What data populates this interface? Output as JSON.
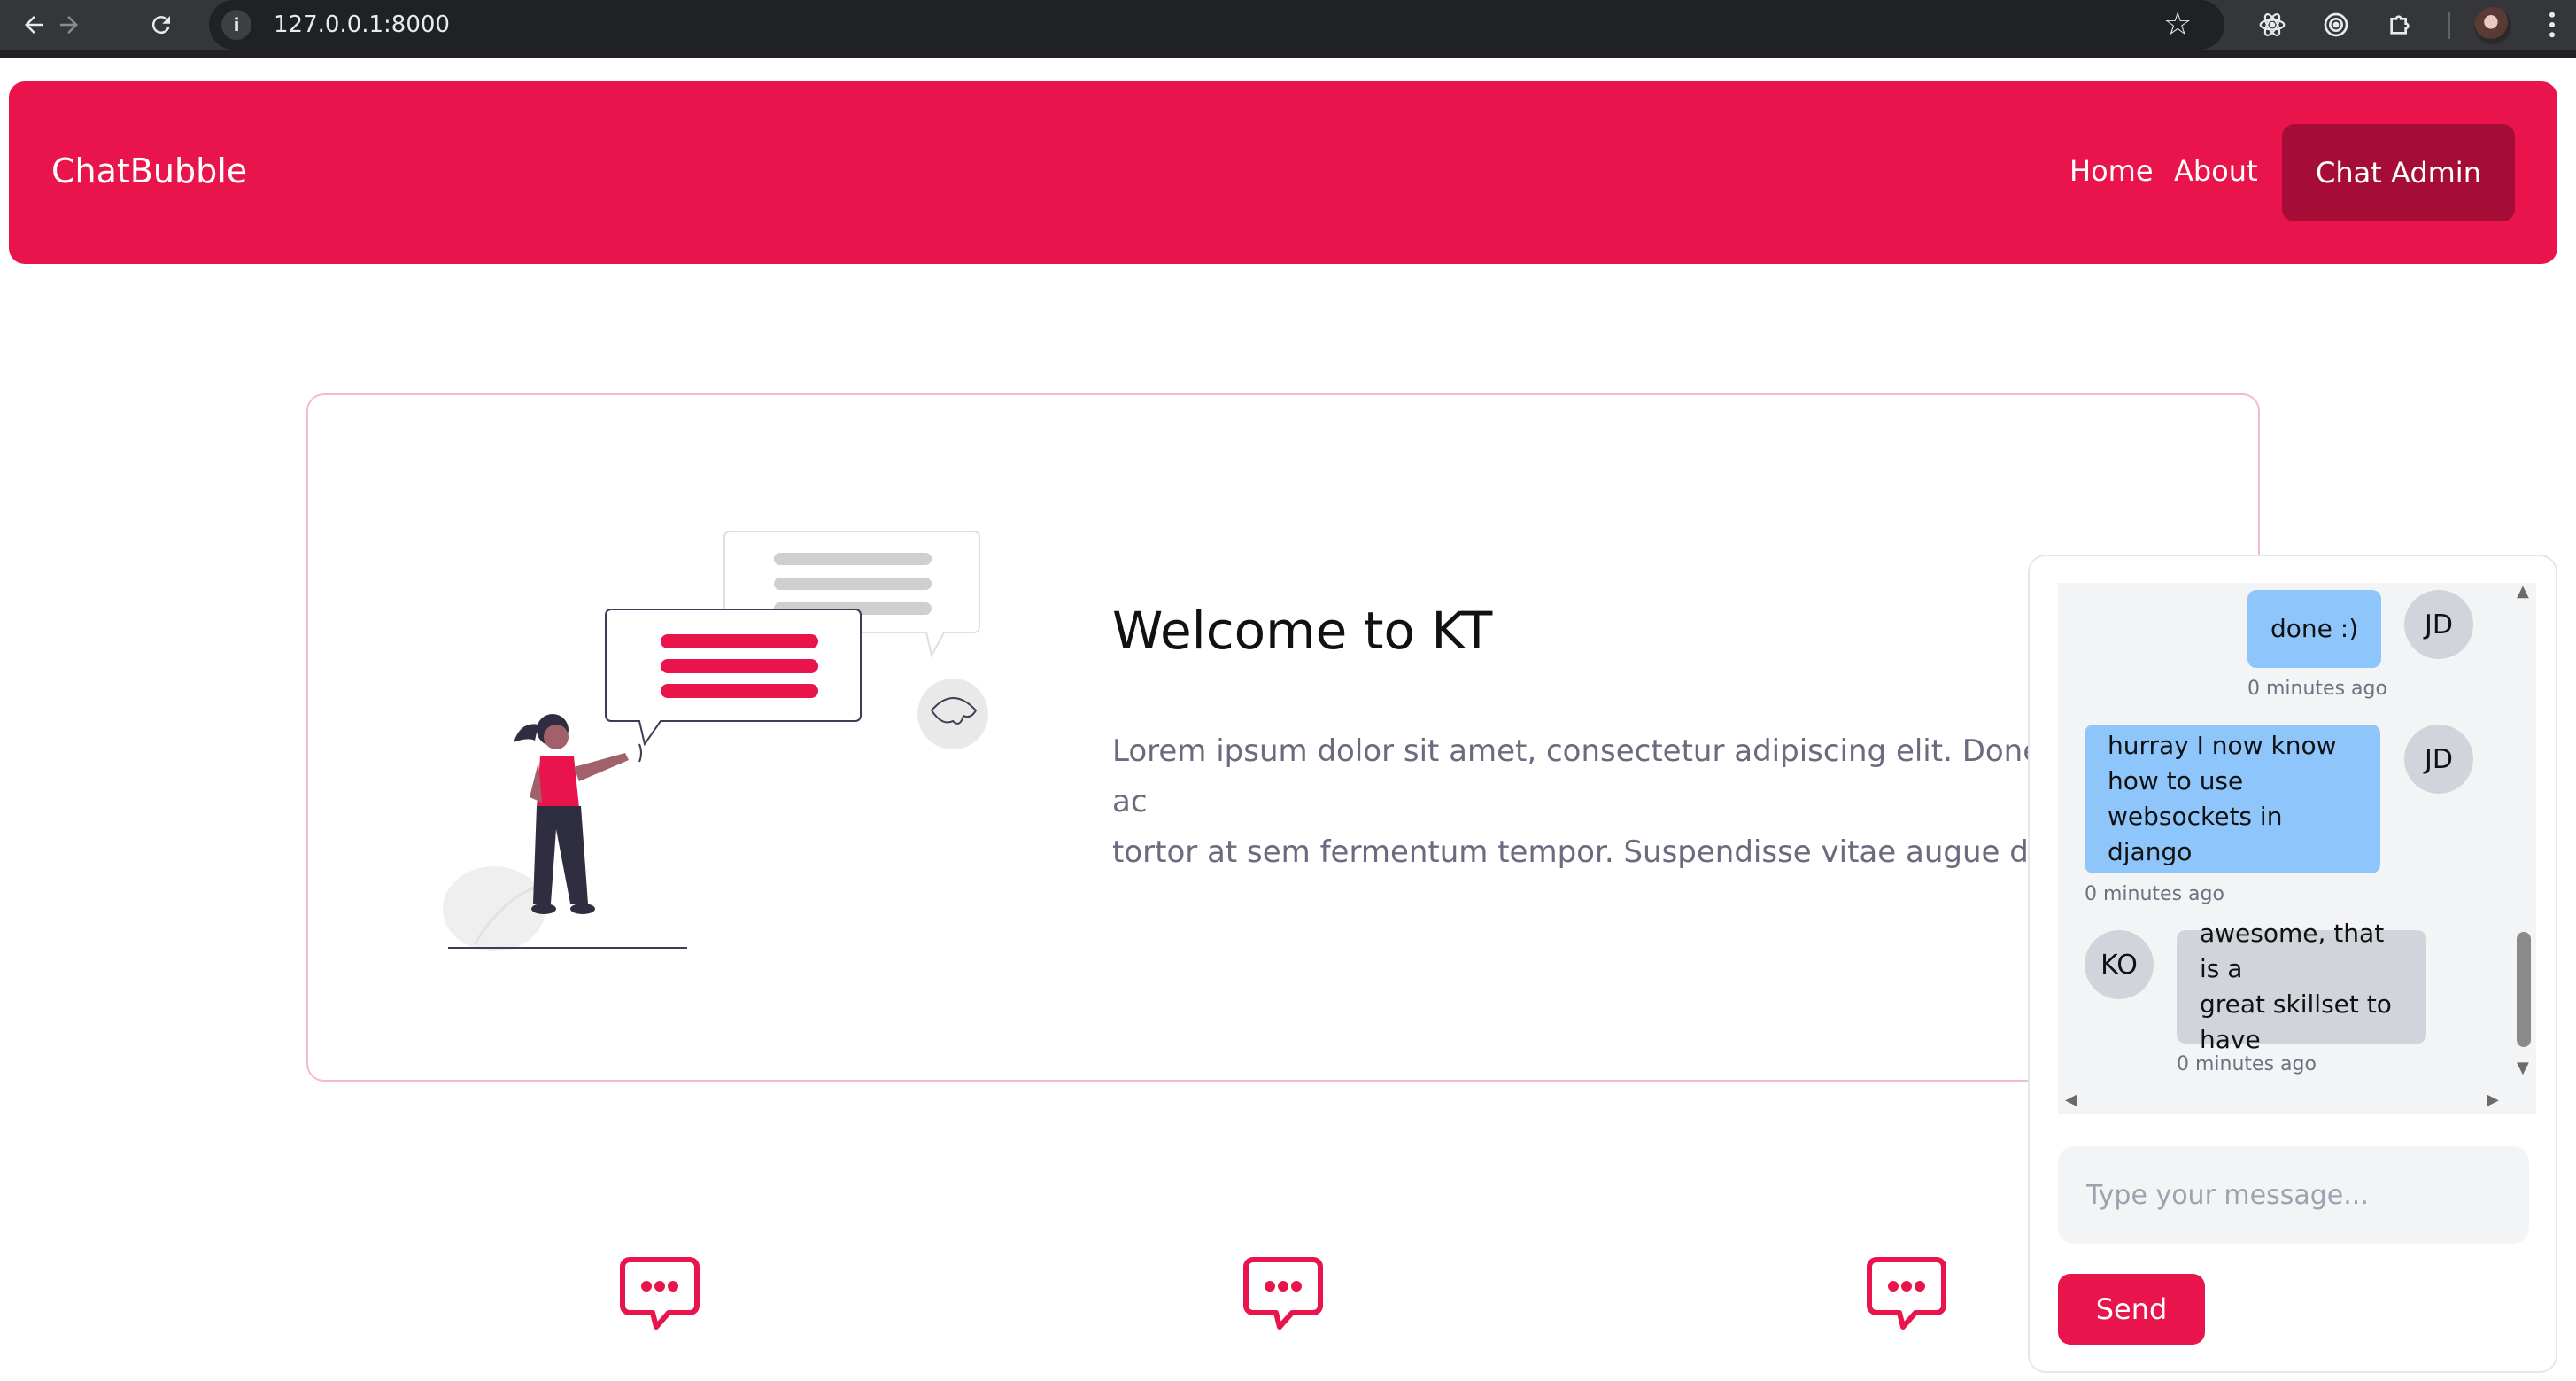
{
  "browser": {
    "url": "127.0.0.1:8000",
    "icons": [
      "back-arrow-icon",
      "forward-arrow-icon",
      "reload-icon",
      "site-info-icon",
      "bookmark-star-icon",
      "react-devtools-icon",
      "extension-target-icon",
      "extensions-puzzle-icon",
      "profile-avatar",
      "kebab-menu-icon"
    ]
  },
  "navbar": {
    "brand": "ChatBubble",
    "links": [
      {
        "label": "Home"
      },
      {
        "label": "About"
      }
    ],
    "admin_button": "Chat Admin",
    "color": "#e8144b"
  },
  "hero": {
    "title": "Welcome to KT",
    "text": "Lorem ipsum dolor sit amet, consectetur adipiscing elit. Donec ac\ntortor at sem fermentum tempor. Suspendisse vitae augue dolor\neleifend nulla."
  },
  "features": {
    "icons": [
      "chat-bubble-icon",
      "chat-bubble-icon",
      "chat-bubble-icon"
    ]
  },
  "chat": {
    "messages": [
      {
        "sender": "JD",
        "text": "done :)",
        "time": "0 minutes ago",
        "own": true
      },
      {
        "sender": "JD",
        "text": "hurray I now know\nhow to use\nwebsockets in django",
        "time": "0 minutes ago",
        "own": true
      },
      {
        "sender": "KO",
        "text": "awesome, that is a\ngreat skillset to have",
        "time": "0 minutes ago",
        "own": false
      }
    ],
    "input_placeholder": "Type your message...",
    "input_value": "",
    "send_label": "Send"
  }
}
